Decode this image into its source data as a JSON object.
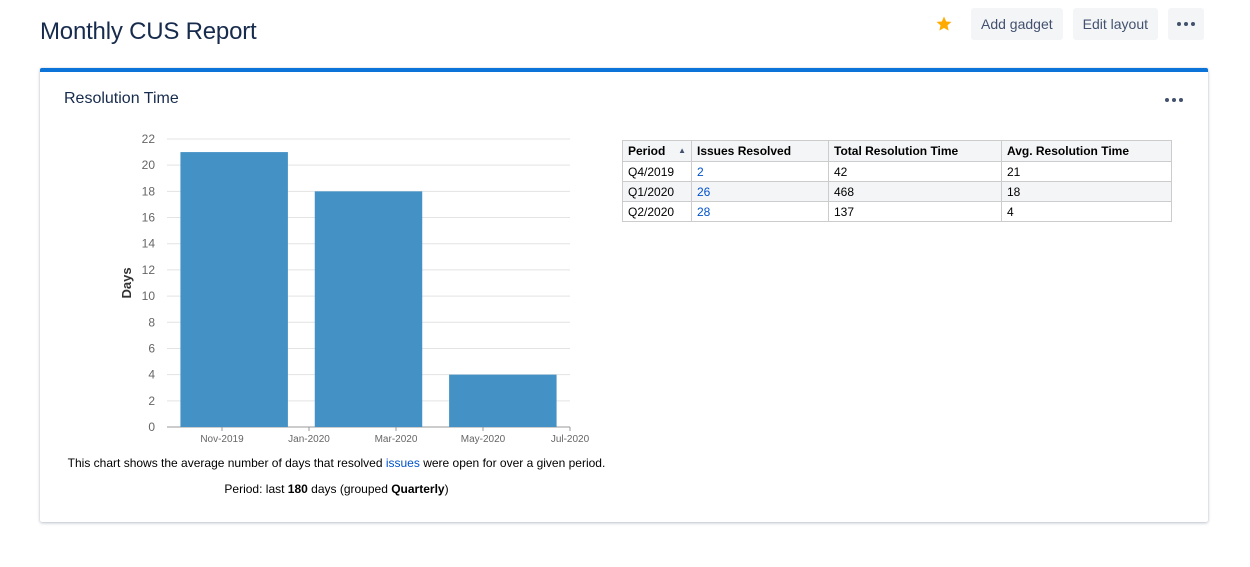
{
  "page": {
    "title": "Monthly CUS Report",
    "actions": {
      "add_gadget": "Add gadget",
      "edit_layout": "Edit layout"
    }
  },
  "gadget": {
    "title": "Resolution Time",
    "caption": {
      "before_link": "This chart shows the average number of days that resolved ",
      "link": "issues",
      "after_link": " were open for over a given period.",
      "period_prefix": "Period: last ",
      "period_days": "180",
      "period_middle": " days (grouped ",
      "period_grouping": "Quarterly",
      "period_suffix": ")"
    }
  },
  "chart_data": {
    "type": "bar",
    "ylabel": "Days",
    "xlabel": "",
    "ylim": [
      0,
      22
    ],
    "yticks": [
      0,
      2,
      4,
      6,
      8,
      10,
      12,
      14,
      16,
      18,
      20,
      22
    ],
    "xticks": [
      "Nov-2019",
      "Jan-2020",
      "Mar-2020",
      "May-2020",
      "Jul-2020"
    ],
    "bars": [
      {
        "period": "Q4/2019",
        "value": 21
      },
      {
        "period": "Q1/2020",
        "value": 18
      },
      {
        "period": "Q2/2020",
        "value": 4
      }
    ],
    "bar_color": "#4391c5",
    "grid": true
  },
  "table": {
    "headers": [
      "Period",
      "Issues Resolved",
      "Total Resolution Time",
      "Avg. Resolution Time"
    ],
    "rows": [
      [
        "Q4/2019",
        "2",
        "42",
        "21"
      ],
      [
        "Q1/2020",
        "26",
        "468",
        "18"
      ],
      [
        "Q2/2020",
        "28",
        "137",
        "4"
      ]
    ]
  },
  "colors": {
    "accent": "#0c74d9",
    "star": "#ffab00",
    "link": "#0052cc"
  }
}
